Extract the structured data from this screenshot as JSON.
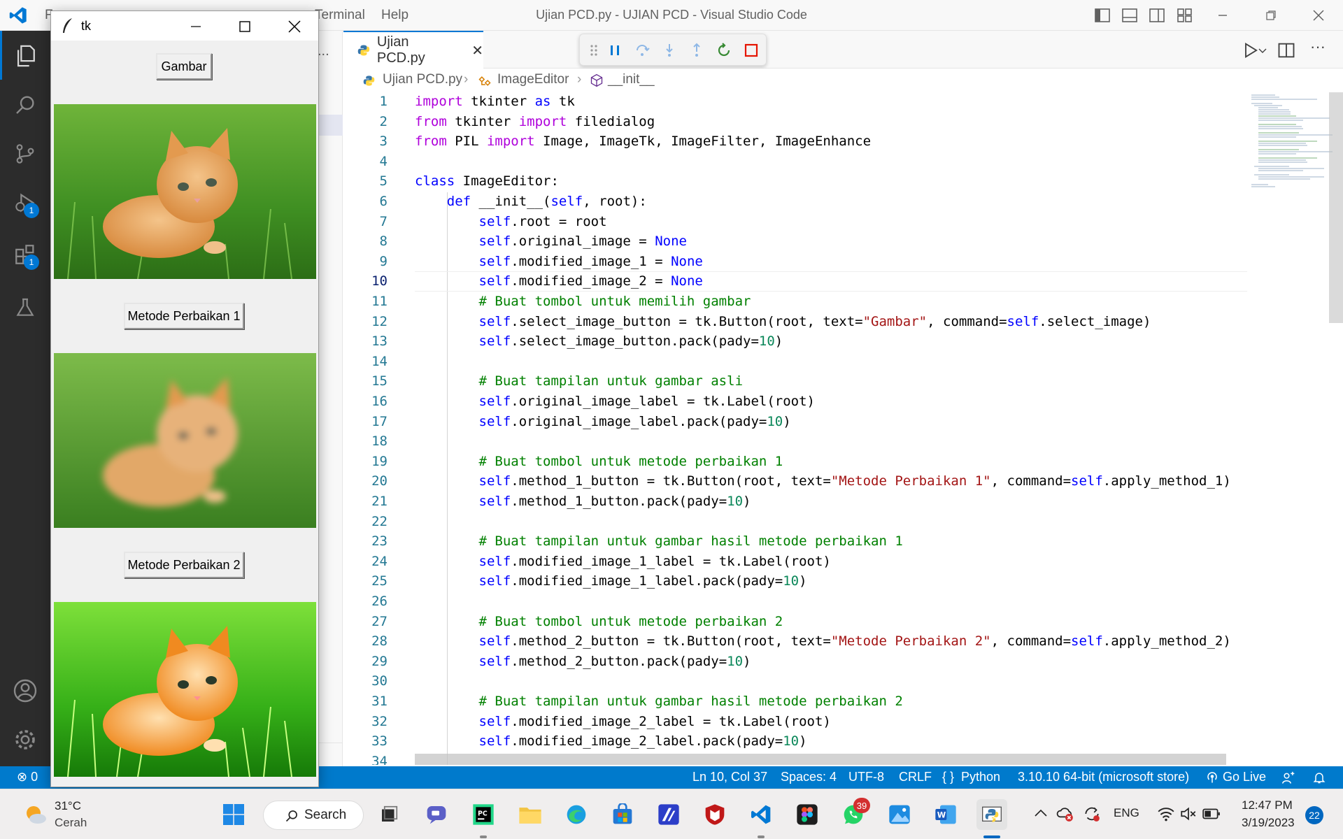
{
  "titlebar": {
    "menu_fragment": "F",
    "menu_terminal": "Terminal",
    "menu_help": "Help",
    "window_title": "Ujian PCD.py - UJIAN PCD - Visual Studio Code"
  },
  "activity": {
    "run_badge": "1",
    "extensions_badge": "1"
  },
  "sidebar": {
    "more": "..."
  },
  "editor": {
    "tab_label": "Ujian PCD.py",
    "breadcrumb": [
      "Ujian PCD.py",
      "ImageEditor",
      "__init__"
    ],
    "active_line": 10,
    "lines": [
      {
        "n": "1",
        "text": "import tkinter as tk"
      },
      {
        "n": "2",
        "text": "from tkinter import filedialog"
      },
      {
        "n": "3",
        "text": "from PIL import Image, ImageTk, ImageFilter, ImageEnhance"
      },
      {
        "n": "4",
        "text": ""
      },
      {
        "n": "5",
        "text": "class ImageEditor:"
      },
      {
        "n": "6",
        "text": "    def __init__(self, root):"
      },
      {
        "n": "7",
        "text": "        self.root = root"
      },
      {
        "n": "8",
        "text": "        self.original_image = None"
      },
      {
        "n": "9",
        "text": "        self.modified_image_1 = None"
      },
      {
        "n": "10",
        "text": "        self.modified_image_2 = None"
      },
      {
        "n": "11",
        "text": "        # Buat tombol untuk memilih gambar"
      },
      {
        "n": "12",
        "text": "        self.select_image_button = tk.Button(root, text=\"Gambar\", command=self.select_image)"
      },
      {
        "n": "13",
        "text": "        self.select_image_button.pack(pady=10)"
      },
      {
        "n": "14",
        "text": ""
      },
      {
        "n": "15",
        "text": "        # Buat tampilan untuk gambar asli"
      },
      {
        "n": "16",
        "text": "        self.original_image_label = tk.Label(root)"
      },
      {
        "n": "17",
        "text": "        self.original_image_label.pack(pady=10)"
      },
      {
        "n": "18",
        "text": ""
      },
      {
        "n": "19",
        "text": "        # Buat tombol untuk metode perbaikan 1"
      },
      {
        "n": "20",
        "text": "        self.method_1_button = tk.Button(root, text=\"Metode Perbaikan 1\", command=self.apply_method_1)"
      },
      {
        "n": "21",
        "text": "        self.method_1_button.pack(pady=10)"
      },
      {
        "n": "22",
        "text": ""
      },
      {
        "n": "23",
        "text": "        # Buat tampilan untuk gambar hasil metode perbaikan 1"
      },
      {
        "n": "24",
        "text": "        self.modified_image_1_label = tk.Label(root)"
      },
      {
        "n": "25",
        "text": "        self.modified_image_1_label.pack(pady=10)"
      },
      {
        "n": "26",
        "text": ""
      },
      {
        "n": "27",
        "text": "        # Buat tombol untuk metode perbaikan 2"
      },
      {
        "n": "28",
        "text": "        self.method_2_button = tk.Button(root, text=\"Metode Perbaikan 2\", command=self.apply_method_2)"
      },
      {
        "n": "29",
        "text": "        self.method_2_button.pack(pady=10)"
      },
      {
        "n": "30",
        "text": ""
      },
      {
        "n": "31",
        "text": "        # Buat tampilan untuk gambar hasil metode perbaikan 2"
      },
      {
        "n": "32",
        "text": "        self.modified_image_2_label = tk.Label(root)"
      },
      {
        "n": "33",
        "text": "        self.modified_image_2_label.pack(pady=10)"
      },
      {
        "n": "34",
        "text": ""
      }
    ]
  },
  "statusbar": {
    "problems": "0",
    "cursor": "Ln 10, Col 37",
    "spaces": "Spaces: 4",
    "encoding": "UTF-8",
    "eol": "CRLF",
    "language": "Python",
    "interpreter": "3.10.10 64-bit (microsoft store)",
    "golive": "Go Live"
  },
  "tk": {
    "title": "tk",
    "btn_gambar": "Gambar",
    "btn_metode1": "Metode Perbaikan 1",
    "btn_metode2": "Metode Perbaikan 2"
  },
  "taskbar": {
    "weather_temp": "31°C",
    "weather_desc": "Cerah",
    "search": "Search",
    "whatsapp_badge": "39",
    "lang": "ENG",
    "time": "12:47 PM",
    "date": "3/19/2023",
    "notif_count": "22"
  },
  "colors": {
    "keyword": "#0000ff",
    "control": "#af00db",
    "string": "#a31515",
    "number": "#098658",
    "comment": "#008000",
    "self": "#0000ff",
    "statusbar": "#007acc"
  }
}
